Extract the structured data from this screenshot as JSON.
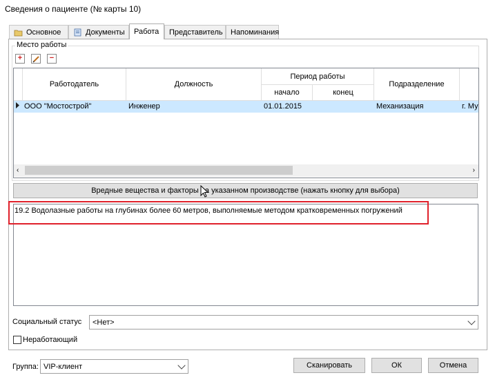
{
  "window": {
    "title": "Сведения о пациенте (№ карты 10)"
  },
  "tabs": [
    {
      "label": "Основное",
      "icon": "folder-icon"
    },
    {
      "label": "Документы",
      "icon": "document-icon"
    },
    {
      "label": "Работа",
      "active": true
    },
    {
      "label": "Представитель"
    },
    {
      "label": "Напоминания"
    }
  ],
  "workplace": {
    "legend": "Место работы",
    "toolbar": {
      "add_icon": "add-icon",
      "edit_icon": "edit-icon",
      "delete_icon": "delete-icon"
    },
    "columns": {
      "employer": "Работодатель",
      "position": "Должность",
      "period": "Период работы",
      "start": "начало",
      "end": "конец",
      "department": "Подразделение"
    },
    "rows": [
      {
        "employer": "ООО \"Мостострой\"",
        "position": "Инженер",
        "start": "01.01.2015",
        "end": "",
        "department": "Механизация",
        "address": "г. Му"
      }
    ]
  },
  "hazards": {
    "button_label": "Вредные вещества и факторы на указанном производстве (нажать кнопку для выбора)",
    "text": "19.2 Водолазные работы на глубинах более 60 метров, выполняемые методом кратковременных погружений"
  },
  "social_status": {
    "label": "Социальный статус",
    "value": "<Нет>"
  },
  "unemployed": {
    "label": "Неработающий",
    "checked": false
  },
  "group": {
    "label": "Группа:",
    "value": "VIP-клиент"
  },
  "buttons": {
    "scan": "Сканировать",
    "ok": "ОК",
    "cancel": "Отмена"
  },
  "colors": {
    "accent_row": "#cce8ff",
    "highlight_box": "#e0202a"
  }
}
